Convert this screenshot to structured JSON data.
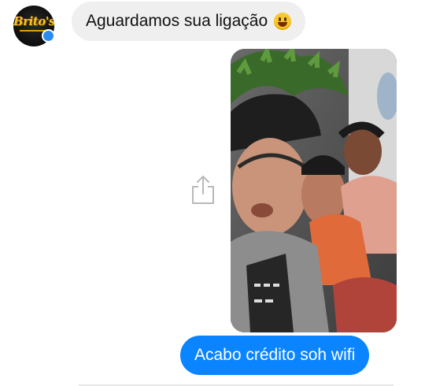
{
  "contact": {
    "avatar_text": "Brito's",
    "avatar_icon": "brand-logo-icon",
    "badge_icon": "messenger-badge-icon"
  },
  "messages": {
    "incoming_text": "Aguardamos sua ligação",
    "incoming_emoji": "smiling-face-emoji",
    "outgoing_text": "Acabo crédito soh wifi"
  },
  "photo": {
    "description_icon": "selfie-photo",
    "share_icon": "share-icon"
  },
  "colors": {
    "incoming_bubble": "#efefef",
    "outgoing_bubble": "#0a84ff",
    "messenger_badge": "#2a8cf0"
  }
}
